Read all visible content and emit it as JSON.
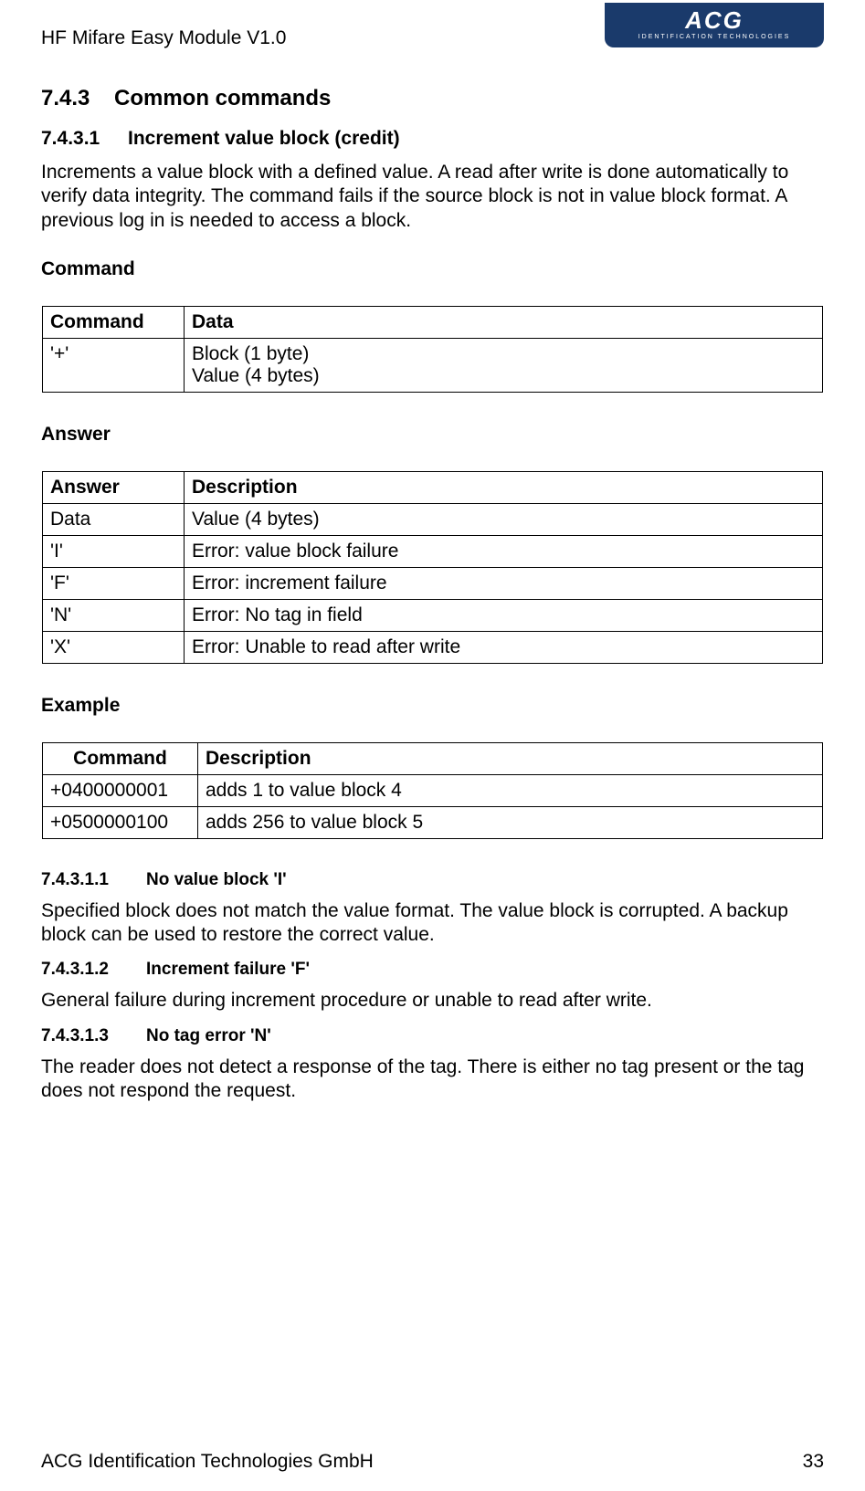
{
  "header": {
    "title": "HF Mifare Easy Module V1.0",
    "logo_main": "ACG",
    "logo_sub": "IDENTIFICATION TECHNOLOGIES"
  },
  "sec_743": {
    "num": "7.4.3",
    "title": "Common commands"
  },
  "sec_7431": {
    "num": "7.4.3.1",
    "title": "Increment value block (credit)"
  },
  "intro": "Increments a value block with a defined value. A read after write is done automatically to verify data integrity. The command fails if the source block is not in value block format. A previous log in is needed to access a block.",
  "labels": {
    "command": "Command",
    "answer": "Answer",
    "example": "Example"
  },
  "command_table": {
    "headers": [
      "Command",
      "Data"
    ],
    "rows": [
      [
        "'+'",
        "Block (1 byte)\nValue (4 bytes)"
      ]
    ]
  },
  "answer_table": {
    "headers": [
      "Answer",
      "Description"
    ],
    "rows": [
      [
        "Data",
        "Value (4 bytes)"
      ],
      [
        "'I'",
        "Error: value block failure"
      ],
      [
        "'F'",
        "Error: increment failure"
      ],
      [
        "'N'",
        "Error: No tag in field"
      ],
      [
        "'X'",
        "Error: Unable to read after write"
      ]
    ]
  },
  "example_table": {
    "headers": [
      "Command",
      "Description"
    ],
    "rows": [
      [
        "+0400000001",
        "adds 1 to value block 4"
      ],
      [
        "+0500000100",
        "adds 256 to value block 5"
      ]
    ]
  },
  "sub1": {
    "num": "7.4.3.1.1",
    "title": "No value block 'I'",
    "body": "Specified block does not match the value format. The value block is corrupted. A backup block can be used to restore the correct value."
  },
  "sub2": {
    "num": "7.4.3.1.2",
    "title": "Increment failure 'F'",
    "body": "General failure during increment procedure or unable to read after write."
  },
  "sub3": {
    "num": "7.4.3.1.3",
    "title": "No tag error 'N'",
    "body": "The reader does not detect a response of the tag. There is either no tag present or the tag does not respond the request."
  },
  "footer": {
    "company": "ACG Identification Technologies GmbH",
    "page": "33"
  }
}
